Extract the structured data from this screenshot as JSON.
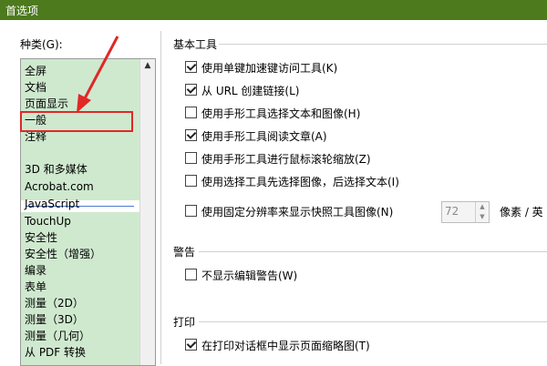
{
  "window": {
    "title": "首选项"
  },
  "categories": {
    "label": "种类(G):",
    "items": [
      {
        "label": "全屏"
      },
      {
        "label": "文档"
      },
      {
        "label": "页面显示"
      },
      {
        "label": "一般"
      },
      {
        "label": "注释"
      },
      {
        "label": "3D 和多媒体"
      },
      {
        "label": "Acrobat.com"
      },
      {
        "label": "JavaScript"
      },
      {
        "label": "TouchUp"
      },
      {
        "label": "安全性"
      },
      {
        "label": "安全性（增强）"
      },
      {
        "label": "编录"
      },
      {
        "label": "表单"
      },
      {
        "label": "测量（2D）"
      },
      {
        "label": "测量（3D）"
      },
      {
        "label": "测量（几何）"
      },
      {
        "label": "从 PDF 转换"
      }
    ],
    "highlighted": "一般"
  },
  "basic_tools": {
    "title": "基本工具",
    "options": [
      {
        "label": "使用单键加速键访问工具(K)",
        "checked": true
      },
      {
        "label": "从 URL 创建链接(L)",
        "checked": true
      },
      {
        "label": "使用手形工具选择文本和图像(H)",
        "checked": false
      },
      {
        "label": "使用手形工具阅读文章(A)",
        "checked": true
      },
      {
        "label": "使用手形工具进行鼠标滚轮缩放(Z)",
        "checked": false
      },
      {
        "label": "使用选择工具先选择图像，后选择文本(I)",
        "checked": false
      },
      {
        "label": "使用固定分辨率来显示快照工具图像(N)",
        "checked": false
      }
    ],
    "snapshot_resolution": "72",
    "unit_label": "像素 / 英"
  },
  "warnings": {
    "title": "警告",
    "options": [
      {
        "label": "不显示编辑警告(W)",
        "checked": false
      }
    ]
  },
  "print": {
    "title": "打印",
    "options": [
      {
        "label": "在打印对话框中显示页面缩略图(T)",
        "checked": true
      }
    ]
  },
  "colors": {
    "titlebar": "#4c7a1d",
    "list_bg": "#cfe9cf",
    "annotation": "#e02828"
  }
}
